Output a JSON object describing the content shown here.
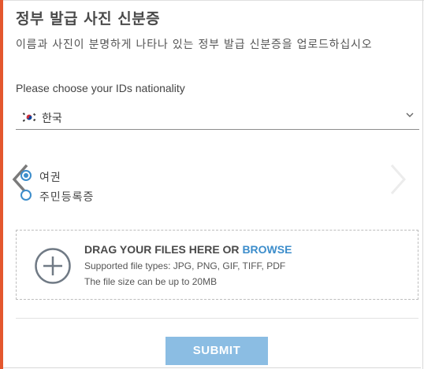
{
  "header": {
    "title": "정부 발급 사진 신분증",
    "subtitle": "이름과 사진이 분명하게 나타나 있는 정부 발급 신분증을 업로드하십시오"
  },
  "nationality": {
    "question": "Please choose your IDs nationality",
    "selected": "한국",
    "flag_icon": "south-korea-flag-icon"
  },
  "document_type": {
    "options": [
      {
        "label": "여권",
        "checked": true
      },
      {
        "label": "주민등록증",
        "checked": false
      }
    ]
  },
  "upload": {
    "title_prefix": "DRAG YOUR FILES HERE OR ",
    "browse_label": "BROWSE",
    "supported_types": "Supported file types: JPG, PNG, GIF, TIFF, PDF",
    "size_limit": "The file size can be up to 20MB"
  },
  "actions": {
    "submit_label": "SUBMIT"
  },
  "colors": {
    "accent": "#e4572e",
    "link": "#3c8dcb",
    "submit_bg": "#8bbde3"
  }
}
